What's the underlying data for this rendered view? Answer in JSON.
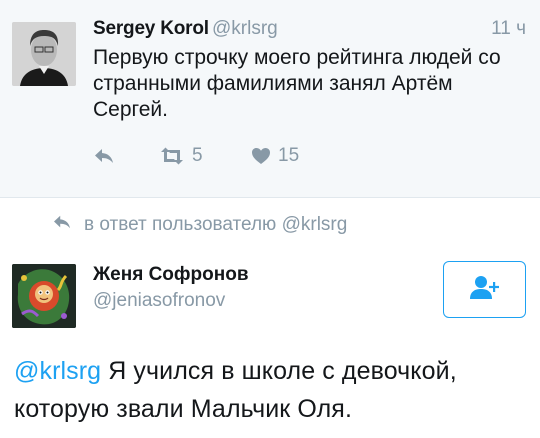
{
  "parent_tweet": {
    "author_name": "Sergey Korol",
    "author_handle": "@krlsrg",
    "time": "11 ч",
    "text": "Первую строчку моего рейтинга людей со странными фамилиями занял Артём Сергей.",
    "retweet_count": "5",
    "like_count": "15",
    "reply_icon": "reply-icon",
    "retweet_icon": "retweet-icon",
    "like_icon": "heart-icon"
  },
  "reply_context": {
    "text": "в ответ пользователю @krlsrg"
  },
  "reply_tweet": {
    "author_name": "Женя Софронов",
    "author_handle": "@jeniasofronov",
    "mention": "@krlsrg",
    "text": " Я учился в школе с девочкой, которую звали Мальчик Оля.",
    "follow_icon": "add-user-icon"
  },
  "colors": {
    "accent": "#1da1f2",
    "muted": "#8899a6",
    "text": "#14171a",
    "parent_background": "#f5f8fa"
  }
}
